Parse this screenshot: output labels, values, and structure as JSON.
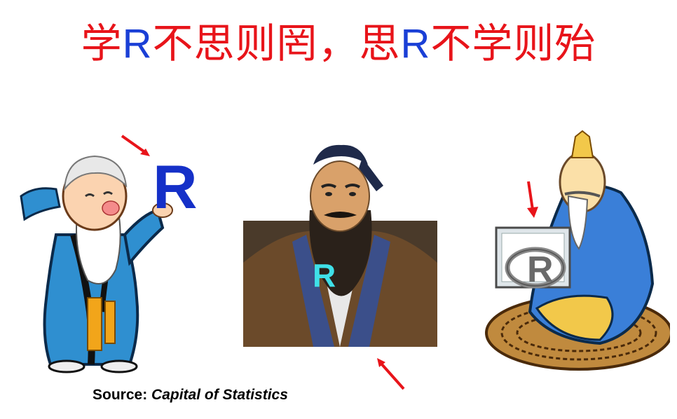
{
  "title": {
    "part1": "学",
    "r1": "R",
    "part2": "不思则罔，思",
    "r2": "R",
    "part3": "不学则殆",
    "color_main": "#e8141a",
    "color_r": "#1a3fd6"
  },
  "figures": {
    "left": {
      "r_label": "R",
      "r_color": "#1530c8"
    },
    "middle": {
      "r_label": "R",
      "r_color": "#3fe0e8"
    },
    "right": {
      "r_label": "R"
    }
  },
  "arrow_color": "#e8141a",
  "source": {
    "label": "Source:",
    "name": "Capital of Statistics"
  }
}
